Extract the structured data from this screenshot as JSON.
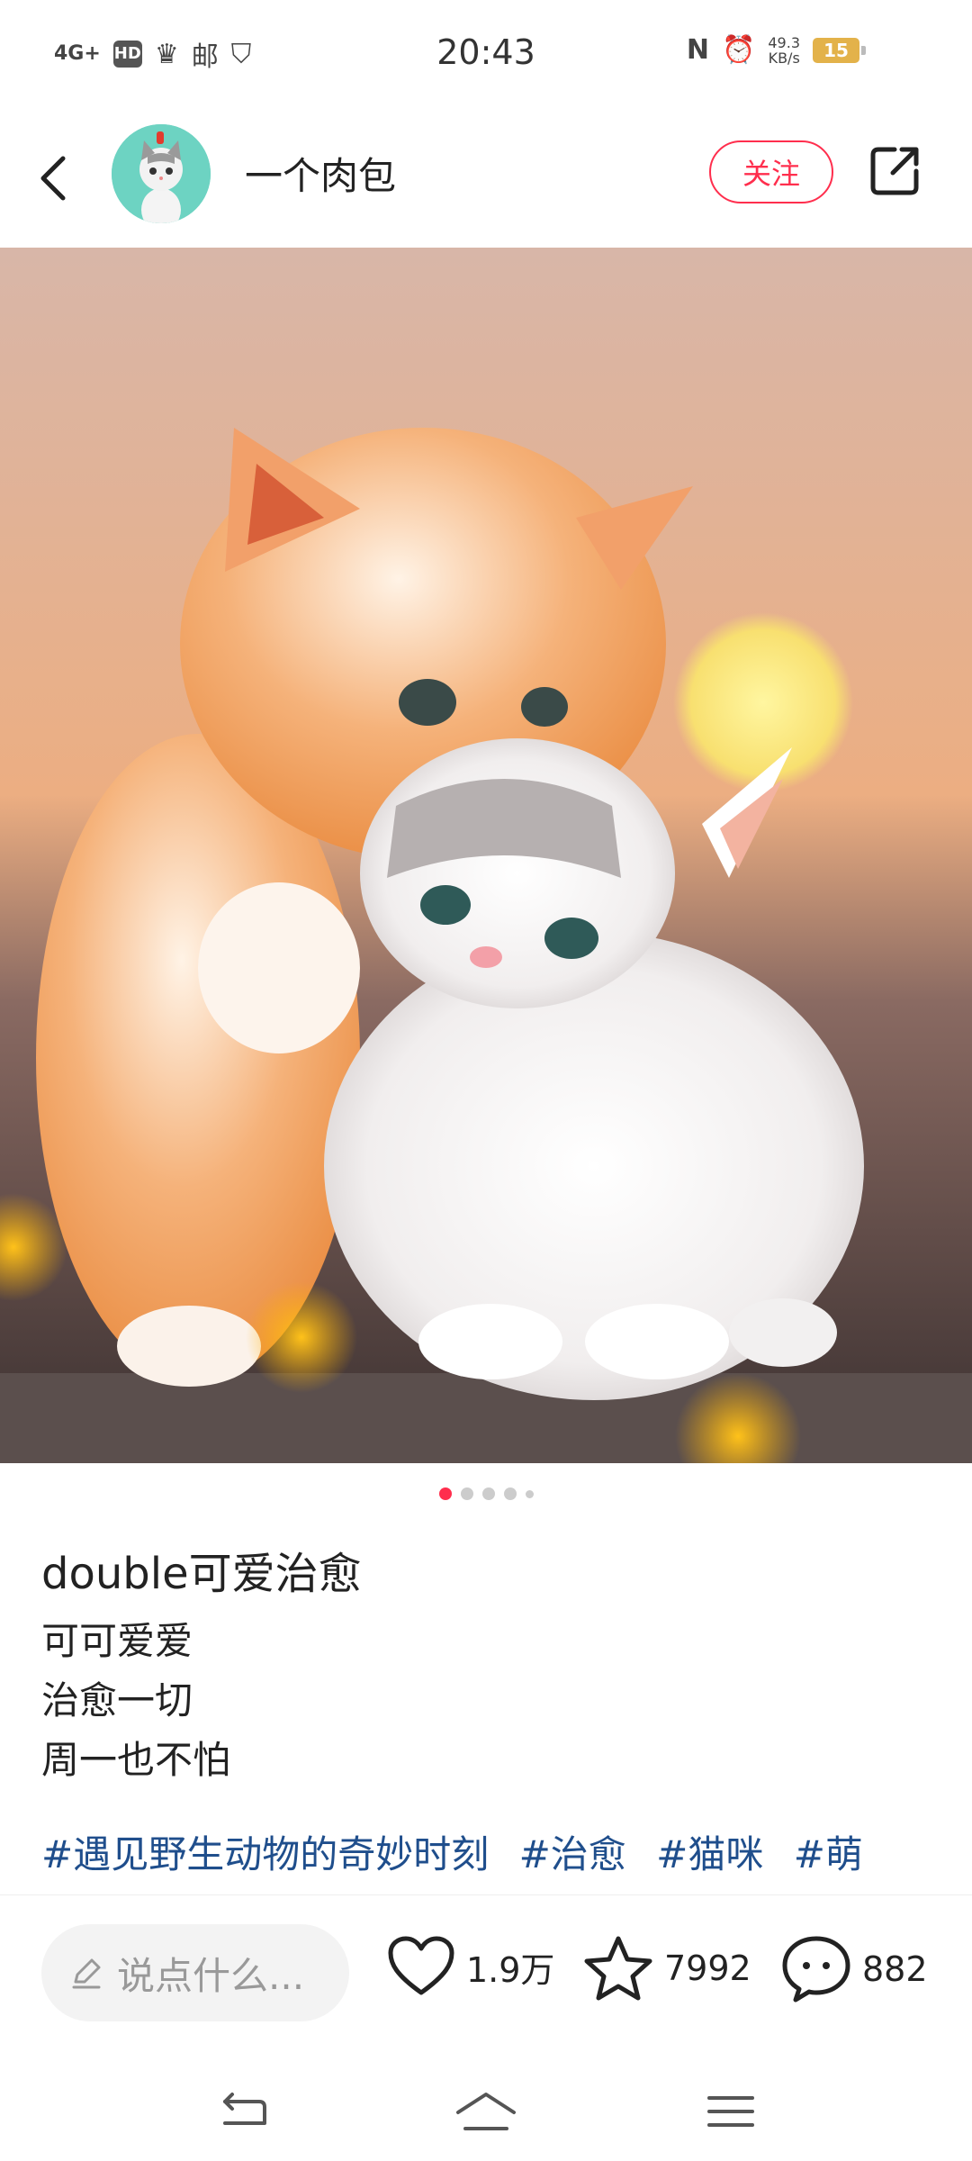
{
  "status": {
    "network": "4G+",
    "hd": "HD",
    "time": "20:43",
    "net_speed": "49.3",
    "net_unit": "KB/s",
    "battery": "15"
  },
  "header": {
    "author": "一个肉包",
    "follow_label": "关注"
  },
  "gallery": {
    "total_pages": 5,
    "current_page": 1
  },
  "post": {
    "title": "double可爱治愈",
    "lines": [
      "可可爱爱",
      "治愈一切",
      "周一也不怕"
    ],
    "tags": [
      "#遇见野生动物的奇妙时刻",
      "#治愈",
      "#猫咪",
      "#萌"
    ]
  },
  "bottom": {
    "comment_placeholder": "说点什么...",
    "likes": "1.9万",
    "favorites": "7992",
    "comments": "882"
  },
  "colors": {
    "accent": "#ff2e4d",
    "tag": "#1f4e8c"
  }
}
